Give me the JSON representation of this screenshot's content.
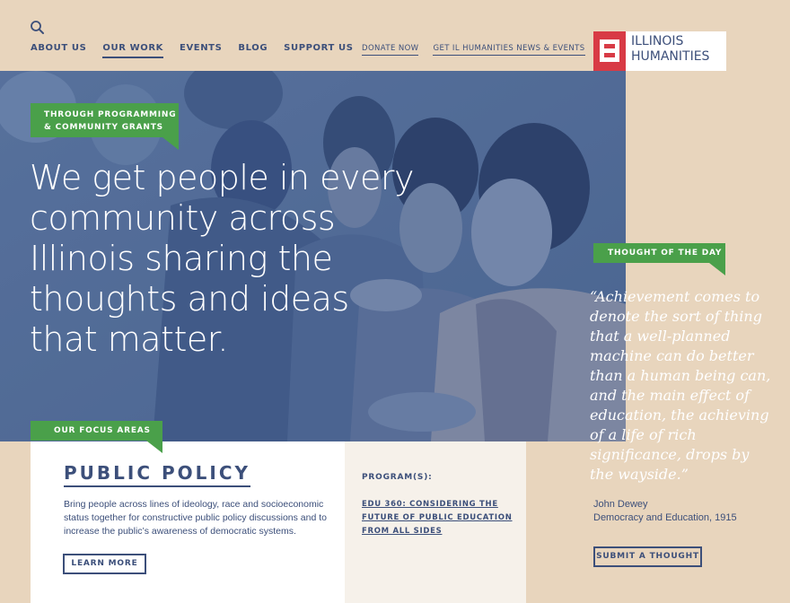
{
  "nav": {
    "search_icon": "search-icon",
    "items": [
      {
        "label": "ABOUT US",
        "active": false
      },
      {
        "label": "OUR WORK",
        "active": true
      },
      {
        "label": "EVENTS",
        "active": false
      },
      {
        "label": "BLOG",
        "active": false
      },
      {
        "label": "SUPPORT US",
        "active": false
      }
    ]
  },
  "utility": {
    "donate": "DONATE NOW",
    "news": "GET IL HUMANITIES NEWS & EVENTS"
  },
  "logo": {
    "line1": "ILLINOIS",
    "line2": "HUMANITIES",
    "mark_color": "#d83a45"
  },
  "hero": {
    "tag_line1": "THROUGH PROGRAMMING",
    "tag_line2": "& COMMUNITY GRANTS",
    "headline": "We get people in every community across Illinois sharing the thoughts and ideas that matter.",
    "overlay_color": "#4e6995"
  },
  "thought": {
    "tag": "THOUGHT OF THE DAY",
    "quote": "“Achievement comes to denote the sort of thing that a well-planned machine can do better than a human being can, and the main effect of education, the achieving of a life of rich significance, drops by the wayside.”",
    "author": "John Dewey",
    "source": "Democracy and Education, 1915",
    "submit_label": "SUBMIT A THOUGHT"
  },
  "focus": {
    "tag": "OUR FOCUS AREAS",
    "title": "PUBLIC POLICY",
    "description": "Bring people across lines of ideology, race and socioeconomic status together for constructive public policy discussions and to increase the public’s awareness of democratic systems.",
    "learn_more": "LEARN MORE"
  },
  "programs": {
    "heading": "PROGRAM(S):",
    "link": "EDU 360: CONSIDERING THE FUTURE OF PUBLIC EDUCATION FROM ALL SIDES"
  },
  "colors": {
    "background": "#e8d5bd",
    "accent_green": "#4aa04a",
    "navy": "#3c4f7a",
    "red": "#d83a45"
  }
}
